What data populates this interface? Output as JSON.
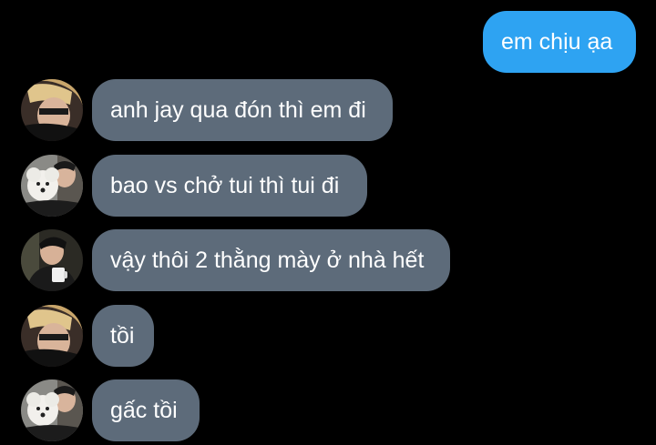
{
  "messages": [
    {
      "direction": "outgoing",
      "text": "em chịu ạa"
    },
    {
      "direction": "incoming",
      "avatar": "avatar-blond-boy",
      "text": "anh jay qua đón thì em đi"
    },
    {
      "direction": "incoming",
      "avatar": "avatar-boy-with-dog",
      "text": "bao vs chở tui thì tui đi"
    },
    {
      "direction": "incoming",
      "avatar": "avatar-boy-with-cup",
      "text": "vậy thôi 2 thằng mày ở nhà hết"
    },
    {
      "direction": "incoming",
      "avatar": "avatar-blond-boy",
      "text": "tồi"
    },
    {
      "direction": "incoming",
      "avatar": "avatar-boy-with-dog",
      "text": "gấc tồi"
    }
  ],
  "colors": {
    "background": "#000000",
    "outgoing_bubble": "#2ea3f2",
    "incoming_bubble": "#5d6b7a",
    "text": "#ffffff"
  }
}
